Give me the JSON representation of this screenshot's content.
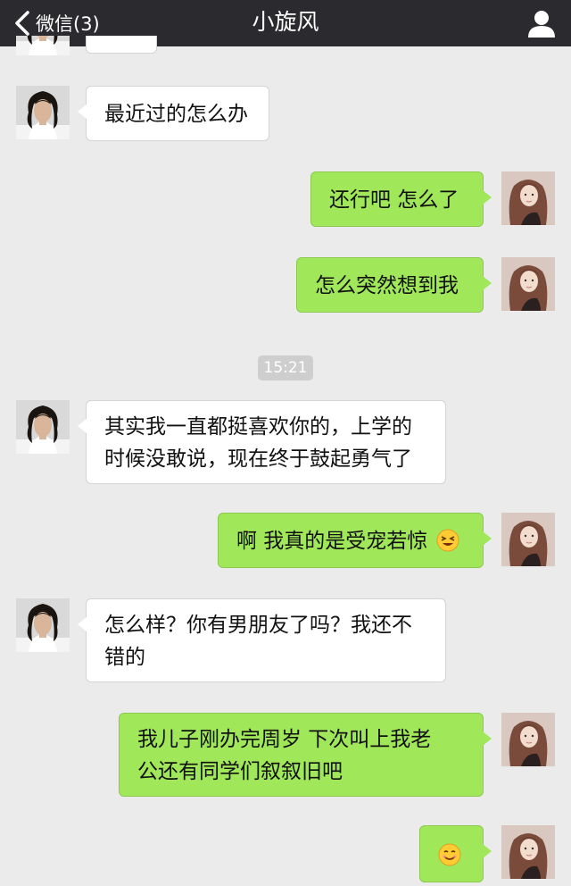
{
  "nav": {
    "back_label": "微信(3)",
    "title": "小旋风",
    "icons": [
      "chevron-left-icon",
      "person-icon"
    ]
  },
  "messages": [
    {
      "side": "left",
      "text": "最近过的怎么办"
    },
    {
      "side": "right",
      "text": "还行吧 怎么了"
    },
    {
      "side": "right",
      "text": "怎么突然想到我"
    },
    {
      "side": "time",
      "text": "15:21"
    },
    {
      "side": "left",
      "text": "其实我一直都挺喜欢你的，上学的时候没敢说，现在终于鼓起勇气了",
      "lines": [
        "其实我一直都挺喜欢你的，上学的",
        "时候没敢说，现在终于鼓起勇气了"
      ]
    },
    {
      "side": "right",
      "text": "啊 我真的是受宠若惊",
      "emoji": "grinning-squint-emoji"
    },
    {
      "side": "left",
      "text": "怎么样？你有男朋友了吗？我还不错的",
      "lines": [
        "怎么样？你有男朋友了吗？我还不",
        "错的"
      ]
    },
    {
      "side": "right",
      "text": "我儿子刚办完周岁 下次叫上我老公还有同学们叙叙旧吧",
      "lines": [
        "我儿子刚办完周岁 下次叫上我老",
        "公还有同学们叙叙旧吧"
      ]
    },
    {
      "side": "right",
      "text": "",
      "emoji": "smiling-emoji"
    }
  ],
  "colors": {
    "nav_bg": "#2b2b2f",
    "chat_bg": "#ebebeb",
    "sent_bubble": "#a0e75a",
    "received_bubble": "#ffffff"
  }
}
